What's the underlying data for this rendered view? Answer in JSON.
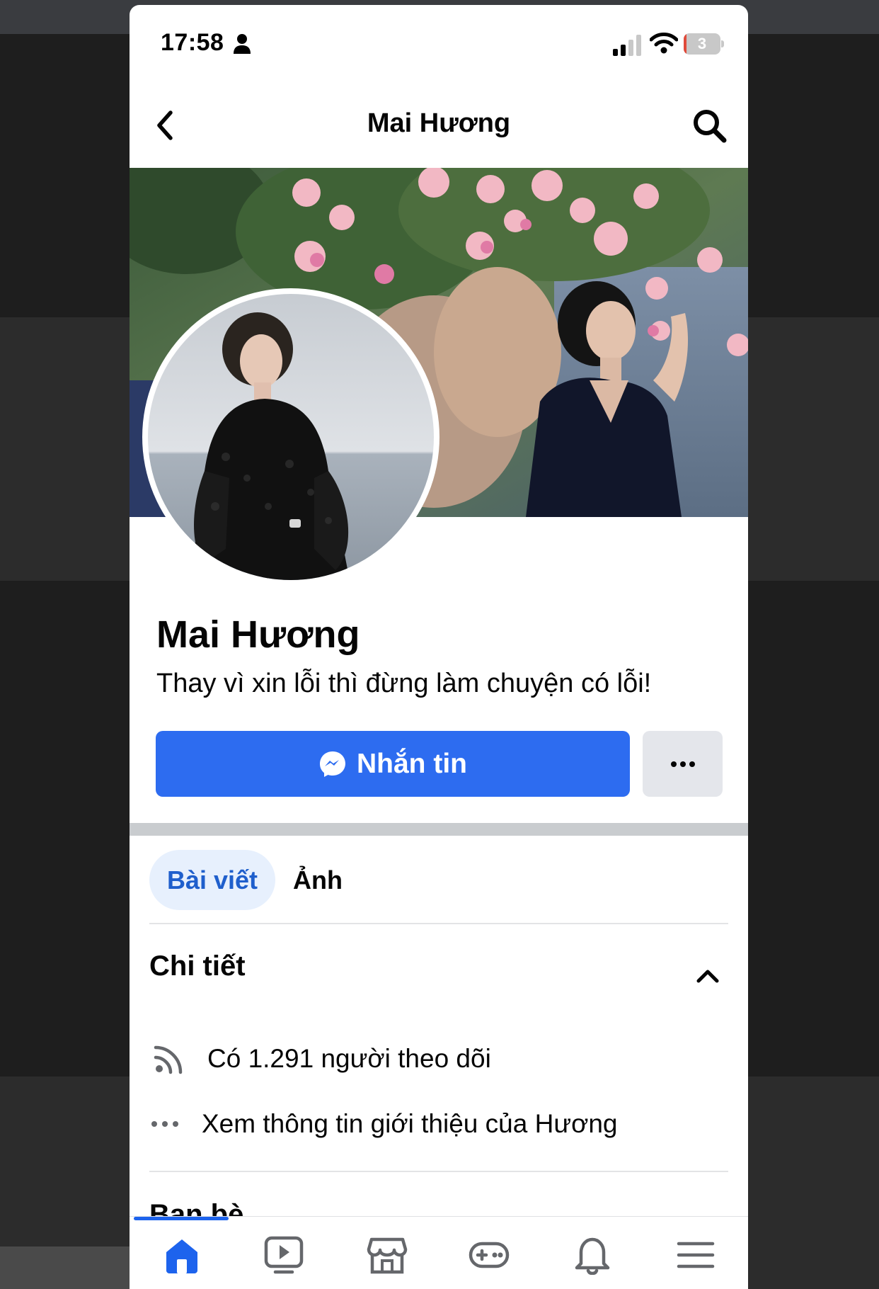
{
  "status_bar": {
    "time": "17:58",
    "battery_level": "3",
    "battery_fraction": 0.03,
    "icons": [
      "person-icon",
      "cellular-signal-icon",
      "wifi-icon",
      "battery-icon"
    ]
  },
  "nav": {
    "title": "Mai Hương",
    "back_icon": "chevron-left-icon",
    "search_icon": "search-icon"
  },
  "profile": {
    "name": "Mai Hương",
    "bio": "Thay vì xin lỗi thì đừng làm chuyện có lỗi!"
  },
  "actions": {
    "message_label": "Nhắn tin",
    "message_icon": "messenger-icon",
    "more_icon": "more-horizontal-icon"
  },
  "tabs": [
    {
      "label": "Bài viết",
      "active": true
    },
    {
      "label": "Ảnh",
      "active": false
    }
  ],
  "details": {
    "title": "Chi tiết",
    "followers_text": "Có 1.291 người theo dõi",
    "about_text": "Xem thông tin giới thiệu của Hương"
  },
  "friends": {
    "title": "Bạn bè"
  },
  "bottom_tabs": [
    {
      "icon": "home-icon",
      "active": true
    },
    {
      "icon": "video-icon",
      "active": false
    },
    {
      "icon": "marketplace-icon",
      "active": false
    },
    {
      "icon": "gaming-icon",
      "active": false
    },
    {
      "icon": "notifications-bell-icon",
      "active": false
    },
    {
      "icon": "menu-icon",
      "active": false
    }
  ],
  "colors": {
    "accent_blue": "#2d6cf0",
    "active_tab_bg": "#e7f0fd",
    "active_tab_text": "#1f5fcc",
    "divider": "#c9cccf"
  }
}
